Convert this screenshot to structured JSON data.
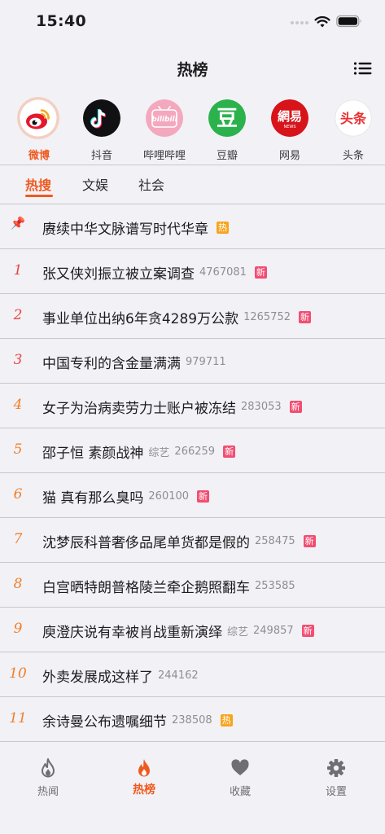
{
  "status_bar": {
    "time": "15:40"
  },
  "nav": {
    "title": "热榜",
    "menu_icon": "list-icon"
  },
  "sources": [
    {
      "label": "微博",
      "icon": "weibo-icon",
      "selected": true,
      "color": "#ef5a1f"
    },
    {
      "label": "抖音",
      "icon": "douyin-icon"
    },
    {
      "label": "哔哩哔哩",
      "icon": "bilibili-icon",
      "icon_text": "bilibili"
    },
    {
      "label": "豆瓣",
      "icon": "douban-icon",
      "icon_text": "豆"
    },
    {
      "label": "网易",
      "icon": "netease-icon",
      "icon_text": "網易",
      "icon_subtext": "NEWS"
    },
    {
      "label": "头条",
      "icon": "toutiao-icon",
      "icon_text": "头条"
    }
  ],
  "tabs": [
    {
      "label": "热搜",
      "active": true
    },
    {
      "label": "文娱"
    },
    {
      "label": "社会"
    }
  ],
  "hot_list": [
    {
      "rank": "📌",
      "title": "赓续中华文脉谱写时代华章",
      "category": "",
      "count": "",
      "badge": "热",
      "badge_color": "#f7a51e"
    },
    {
      "rank": "1",
      "title": "张又侠刘振立被立案调查",
      "category": "",
      "count": "4767081",
      "badge": "新",
      "badge_color": "#f24e72",
      "rank_color": "#e8453c"
    },
    {
      "rank": "2",
      "title": "事业单位出纳6年贪4289万公款",
      "category": "",
      "count": "1265752",
      "badge": "新",
      "badge_color": "#f24e72",
      "rank_color": "#e8453c"
    },
    {
      "rank": "3",
      "title": "中国专利的含金量满满",
      "category": "",
      "count": "979711",
      "badge": "",
      "rank_color": "#e8453c"
    },
    {
      "rank": "4",
      "title": "女子为治病卖劳力士账户被冻结",
      "category": "",
      "count": "283053",
      "badge": "新",
      "badge_color": "#f24e72",
      "rank_color": "#f07f2a"
    },
    {
      "rank": "5",
      "title": "邵子恒 素颜战神",
      "category": "综艺",
      "count": "266259",
      "badge": "新",
      "badge_color": "#f24e72",
      "rank_color": "#f07f2a"
    },
    {
      "rank": "6",
      "title": "猫 真有那么臭吗",
      "category": "",
      "count": "260100",
      "badge": "新",
      "badge_color": "#f24e72",
      "rank_color": "#f07f2a"
    },
    {
      "rank": "7",
      "title": "沈梦辰科普奢侈品尾单货都是假的",
      "category": "",
      "count": "258475",
      "badge": "新",
      "badge_color": "#f24e72",
      "rank_color": "#f07f2a"
    },
    {
      "rank": "8",
      "title": "白宫晒特朗普格陵兰牵企鹅照翻车",
      "category": "",
      "count": "253585",
      "badge": "",
      "rank_color": "#f07f2a"
    },
    {
      "rank": "9",
      "title": "庾澄庆说有幸被肖战重新演绎",
      "category": "综艺",
      "count": "249857",
      "badge": "新",
      "badge_color": "#f24e72",
      "rank_color": "#f07f2a"
    },
    {
      "rank": "10",
      "title": "外卖发展成这样了",
      "category": "",
      "count": "244162",
      "badge": "",
      "rank_color": "#f07f2a"
    },
    {
      "rank": "11",
      "title": "余诗曼公布遗嘱细节",
      "category": "",
      "count": "238508",
      "badge": "热",
      "badge_color": "#f7a51e",
      "rank_color": "#f07f2a"
    }
  ],
  "tabbar": [
    {
      "label": "热闻",
      "icon": "flame-outline-icon"
    },
    {
      "label": "热榜",
      "icon": "flame-icon",
      "active": true
    },
    {
      "label": "收藏",
      "icon": "heart-icon"
    },
    {
      "label": "设置",
      "icon": "gear-icon"
    }
  ],
  "colors": {
    "accent": "#ef5a1f",
    "background": "#f2f1f6",
    "new_badge": "#f24e72",
    "hot_badge": "#f7a51e"
  }
}
